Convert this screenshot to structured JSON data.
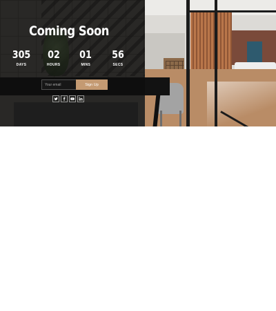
{
  "page": {
    "title": "Coming Soon"
  },
  "countdown": [
    {
      "value": "305",
      "label": "DAYS"
    },
    {
      "value": "02",
      "label": "HOURS"
    },
    {
      "value": "01",
      "label": "MINS"
    },
    {
      "value": "56",
      "label": "SECS"
    }
  ],
  "signup_form": {
    "email_placeholder": "Your email",
    "submit_label": "Sign Up"
  },
  "social_links": [
    {
      "icon": "twitter-icon"
    },
    {
      "icon": "facebook-icon"
    },
    {
      "icon": "youtube-icon"
    },
    {
      "icon": "linkedin-icon"
    }
  ],
  "colors": {
    "accent": "#c49a72",
    "text": "#ffffff",
    "page_background": "#ffffff"
  }
}
